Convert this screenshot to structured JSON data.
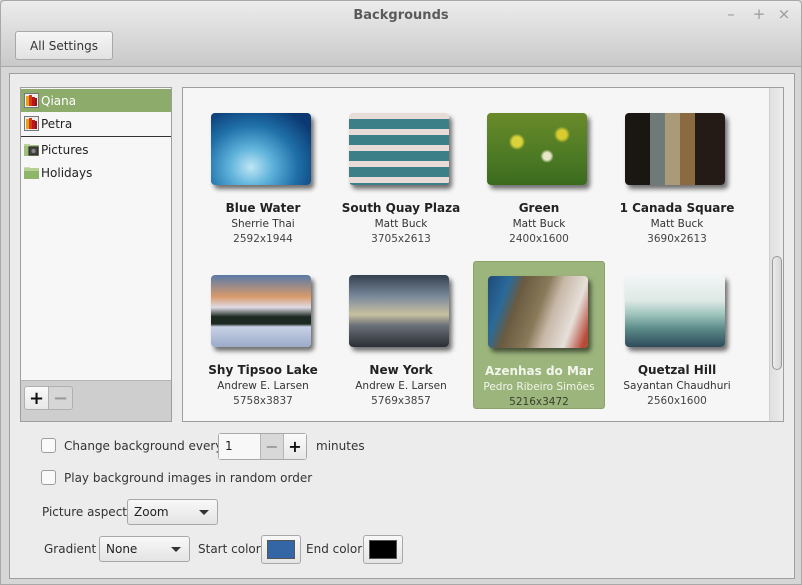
{
  "window": {
    "title": "Backgrounds",
    "controls": {
      "minimize": "–",
      "maximize": "+",
      "close": "×"
    }
  },
  "toolbar": {
    "all_settings_label": "All Settings"
  },
  "sidebar": {
    "items": [
      {
        "label": "Qiana",
        "icon": "wallpaper-collection-icon",
        "selected": true
      },
      {
        "label": "Petra",
        "icon": "wallpaper-collection-icon",
        "selected": false
      },
      {
        "label": "Pictures",
        "icon": "pictures-folder-icon",
        "selected": false
      },
      {
        "label": "Holidays",
        "icon": "folder-icon",
        "selected": false
      }
    ],
    "add_label": "+",
    "remove_label": "−"
  },
  "gallery": {
    "items": [
      {
        "name": "Blue Water",
        "author": "Sherrie Thai",
        "resolution": "2592x1944",
        "selected": false
      },
      {
        "name": "South Quay Plaza",
        "author": "Matt Buck",
        "resolution": "3705x2613",
        "selected": false
      },
      {
        "name": "Green",
        "author": "Matt Buck",
        "resolution": "2400x1600",
        "selected": false
      },
      {
        "name": "1 Canada Square",
        "author": "Matt Buck",
        "resolution": "3690x2613",
        "selected": false
      },
      {
        "name": "Shy Tipsoo Lake",
        "author": "Andrew E. Larsen",
        "resolution": "5758x3837",
        "selected": false
      },
      {
        "name": "New York",
        "author": "Andrew E. Larsen",
        "resolution": "5769x3857",
        "selected": false
      },
      {
        "name": "Azenhas do Mar",
        "author": "Pedro Ribeiro Simões",
        "resolution": "5216x3472",
        "selected": true
      },
      {
        "name": "Quetzal Hill",
        "author": "Sayantan Chaudhuri",
        "resolution": "2560x1600",
        "selected": false
      }
    ]
  },
  "options": {
    "change_every_label": "Change background every",
    "change_every_checked": false,
    "interval_value": "1",
    "interval_unit": "minutes",
    "spin_minus": "−",
    "spin_plus": "+",
    "random_order_label": "Play background images in random order",
    "random_order_checked": false,
    "picture_aspect_label": "Picture aspect",
    "picture_aspect_value": "Zoom",
    "gradient_label": "Gradient",
    "gradient_value": "None",
    "start_color_label": "Start color",
    "start_color": "#3465a4",
    "end_color_label": "End color",
    "end_color": "#000000"
  },
  "colors": {
    "selection": "#8dac6c",
    "selected_tile": "#9cb57c"
  }
}
